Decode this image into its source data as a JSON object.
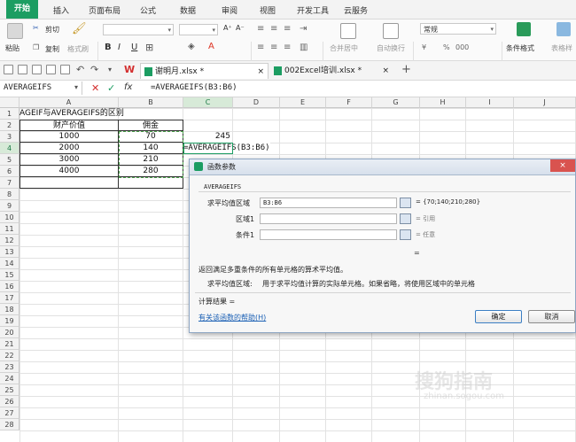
{
  "menu": {
    "tabs": [
      "开始",
      "插入",
      "页面布局",
      "公式",
      "数据",
      "审阅",
      "视图",
      "开发工具",
      "云服务"
    ]
  },
  "ribbon": {
    "paste": "粘贴",
    "cut": "剪切",
    "copy": "复制",
    "format_painter": "格式刷",
    "font_bold": "B",
    "font_italic": "I",
    "font_underline": "U",
    "font_grow": "A⁺",
    "font_shrink": "A⁻",
    "merge_center": "合并居中",
    "wrap_text": "自动换行",
    "number_format": "常规",
    "percent": "%",
    "thousands": "000",
    "conditional_format": "条件格式",
    "table_style": "表格样"
  },
  "quickbar": {
    "doc_tabs": [
      {
        "name": "谢明月.xlsx *",
        "active": true,
        "close": "×"
      },
      {
        "name": "002Excel培训.xlsx *",
        "active": false,
        "close": "×"
      }
    ],
    "add_tab": "+"
  },
  "formula_bar": {
    "name_box": "AVERAGEIFS",
    "cancel": "✕",
    "confirm": "✓",
    "fx": "fx",
    "formula": "=AVERAGEIFS(B3:B6)"
  },
  "sheet": {
    "columns": [
      "A",
      "B",
      "C",
      "D",
      "E",
      "F",
      "G",
      "H",
      "I",
      "J"
    ],
    "selected_column": "C",
    "rows": [
      "1",
      "2",
      "3",
      "4",
      "5",
      "6",
      "7",
      "8",
      "9",
      "10",
      "11",
      "12",
      "13",
      "14",
      "15",
      "16",
      "17",
      "18",
      "19",
      "20",
      "21",
      "22",
      "23",
      "24",
      "25",
      "26",
      "27",
      "28"
    ],
    "selected_row": "4",
    "title": "AGEIF与AVERAGEIFS的区别",
    "header_a": "财产价值",
    "header_b": "佣金",
    "data": [
      {
        "a": "1000",
        "b": "70"
      },
      {
        "a": "2000",
        "b": "140"
      },
      {
        "a": "3000",
        "b": "210"
      },
      {
        "a": "4000",
        "b": "280"
      }
    ],
    "c3": "245",
    "c4_formula": "=AVERAGEIFS(B3:B6)"
  },
  "dialog": {
    "title": "函数参数",
    "close": "×",
    "function_name": "AVERAGEIFS",
    "params": [
      {
        "label": "求平均值区域",
        "value": "B3:B6",
        "result": "= {70;140;210;280}"
      },
      {
        "label": "区域1",
        "value": "",
        "result": "= 引用"
      },
      {
        "label": "条件1",
        "value": "",
        "result": "= 任意"
      }
    ],
    "total_eq": "=",
    "description": "返回满足多重条件的所有单元格的算术平均值。",
    "param_help_label": "求平均值区域:",
    "param_help_text": "用于求平均值计算的实际单元格。如果省略，将使用区域中的单元格",
    "calc_result_label": "计算结果 =",
    "help_link": "有关该函数的帮助(H)",
    "ok": "确定",
    "cancel": "取消"
  },
  "watermark": {
    "main": "搜狗指南",
    "sub": "zhinan.sogou.com"
  },
  "colors": {
    "accent_green": "#1c9d62",
    "selection_dash": "#4aa04a",
    "link_blue": "#1a5fb4"
  }
}
